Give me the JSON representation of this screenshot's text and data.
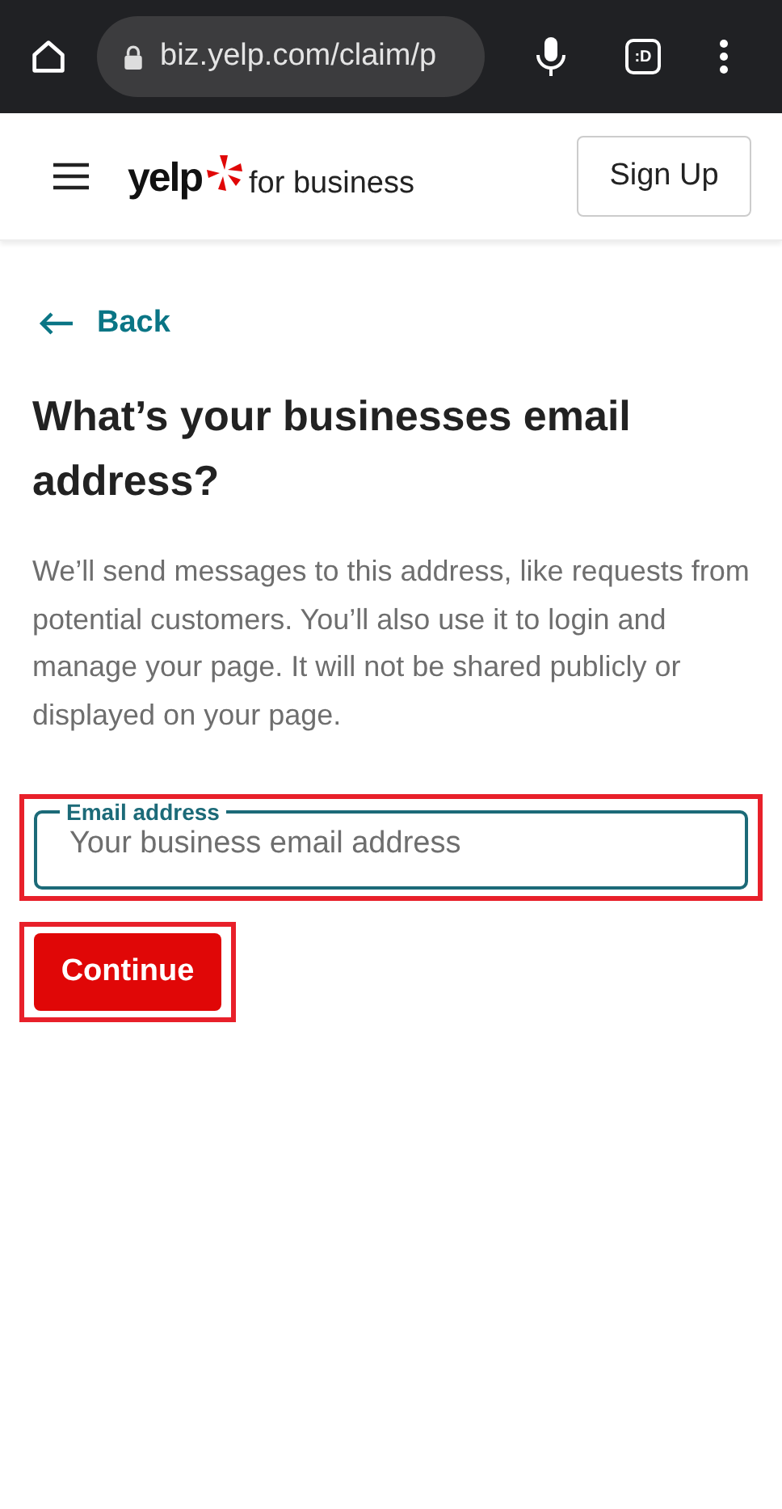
{
  "browser_bar": {
    "url": "biz.yelp.com/claim/p",
    "tab_count": ":D"
  },
  "header": {
    "logo_word": "yelp",
    "logo_suffix": "for business",
    "sign_up": "Sign Up"
  },
  "back": {
    "label": "Back"
  },
  "title": "What’s your businesses email address?",
  "description": "We’ll send messages to this address, like requests from potential customers. You’ll also use it to login and manage your page. It will not be shared publicly or displayed on your page.",
  "email_field": {
    "label": "Email address",
    "placeholder": "Your business email address",
    "highlighted": true
  },
  "continue_button": {
    "label": "Continue",
    "highlighted": true
  }
}
